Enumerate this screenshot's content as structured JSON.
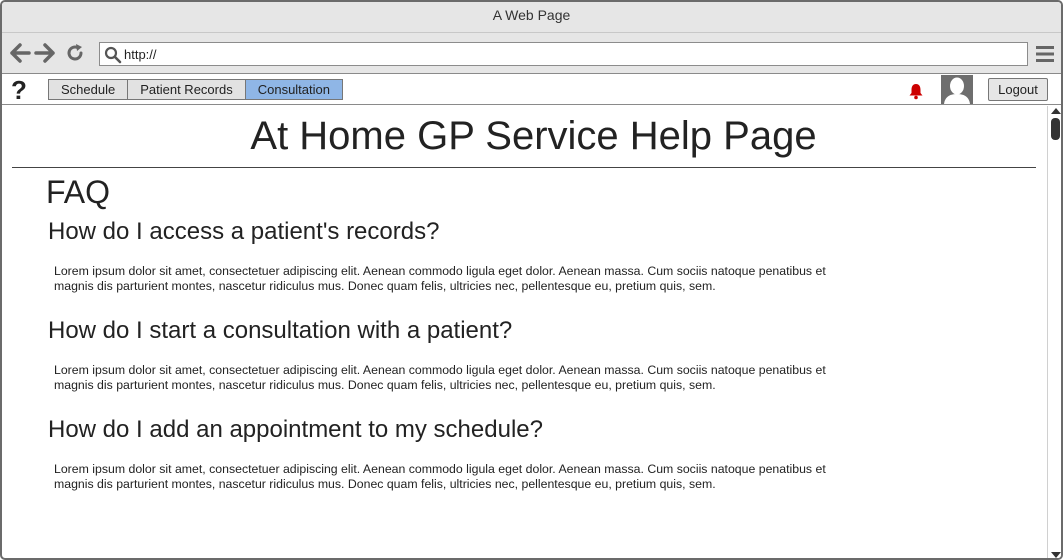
{
  "window": {
    "title": "A Web Page"
  },
  "browser": {
    "url": "http://",
    "icons": [
      "back-arrow-icon",
      "forward-arrow-icon",
      "reload-icon",
      "search-icon",
      "hamburger-menu-icon"
    ]
  },
  "appbar": {
    "help_icon": "?",
    "tabs": [
      {
        "label": "Schedule",
        "active": false
      },
      {
        "label": "Patient Records",
        "active": false
      },
      {
        "label": "Consultation",
        "active": true
      }
    ],
    "logout_label": "Logout",
    "accent_color": "#8fb6e6",
    "bell_color": "#cc0000"
  },
  "page": {
    "title": "At Home GP Service Help Page",
    "faq_heading": "FAQ",
    "faqs": [
      {
        "question": "How do I access a patient's records?",
        "answer": "Lorem ipsum dolor sit amet, consectetuer adipiscing elit. Aenean commodo ligula eget dolor. Aenean massa. Cum sociis natoque penatibus et magnis dis parturient montes, nascetur ridiculus mus. Donec quam felis, ultricies nec, pellentesque eu, pretium quis, sem."
      },
      {
        "question": "How do I start a consultation with a patient?",
        "answer": "Lorem ipsum dolor sit amet, consectetuer adipiscing elit. Aenean commodo ligula eget dolor. Aenean massa. Cum sociis natoque penatibus et magnis dis parturient montes, nascetur ridiculus mus. Donec quam felis, ultricies nec, pellentesque eu, pretium quis, sem."
      },
      {
        "question": "How do I add an appointment to my schedule?",
        "answer": "Lorem ipsum dolor sit amet, consectetuer adipiscing elit. Aenean commodo ligula eget dolor. Aenean massa. Cum sociis natoque penatibus et magnis dis parturient montes, nascetur ridiculus mus. Donec quam felis, ultricies nec, pellentesque eu, pretium quis, sem."
      }
    ]
  }
}
